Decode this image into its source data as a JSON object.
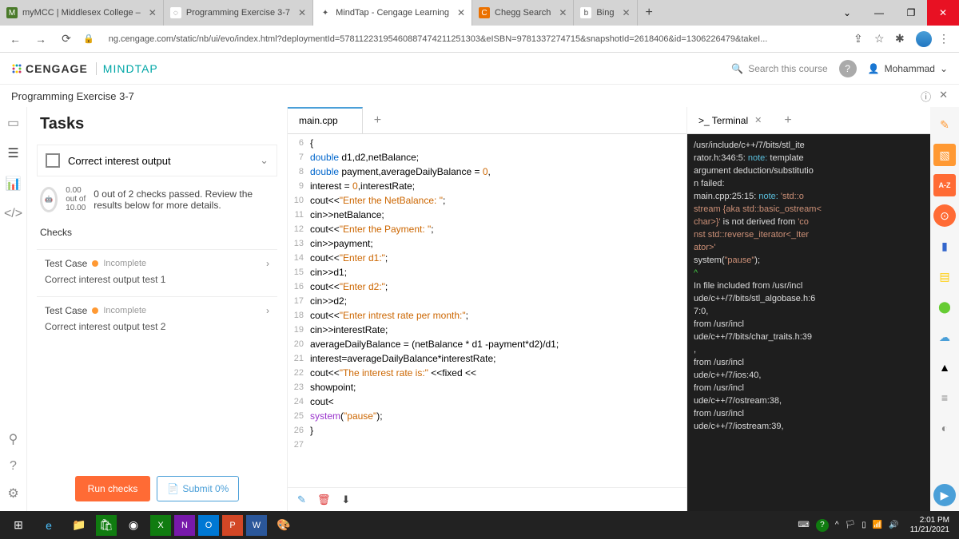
{
  "browser": {
    "tabs": [
      {
        "label": "myMCC | Middlesex College – ",
        "icon": "M",
        "iconbg": "#4a7a2a"
      },
      {
        "label": "Programming Exercise 3-7",
        "icon": "◌",
        "iconbg": "#fff"
      },
      {
        "label": "MindTap - Cengage Learning",
        "icon": "✦",
        "iconbg": "#fff",
        "active": true
      },
      {
        "label": "Chegg Search",
        "icon": "C",
        "iconbg": "#eb7100"
      },
      {
        "label": "Bing",
        "icon": "b",
        "iconbg": "#fff"
      }
    ],
    "url": "ng.cengage.com/static/nb/ui/evo/index.html?deploymentId=57811223195460887474211251303&eISBN=9781337274715&snapshotId=2618406&id=1306226479&takeI..."
  },
  "cengage": {
    "brand": "CENGAGE",
    "product": "MINDTAP",
    "search_placeholder": "Search this course",
    "user": "Mohammad"
  },
  "exercise": {
    "title": "Programming Exercise 3-7"
  },
  "tasks": {
    "heading": "Tasks",
    "item": "Correct interest output",
    "score_num": "0.00",
    "score_den": "10.00",
    "score_mid": "out of",
    "status": "0 out of 2 checks passed. Review the results below for more details.",
    "checks_heading": "Checks",
    "checks": [
      {
        "title": "Test Case",
        "state": "Incomplete",
        "sub": "Correct interest output test 1"
      },
      {
        "title": "Test Case",
        "state": "Incomplete",
        "sub": "Correct interest output test 2"
      }
    ],
    "run": "Run checks",
    "submit": "Submit 0%"
  },
  "editor": {
    "tab": "main.cpp",
    "lines": [
      {
        "n": "6",
        "html": "{"
      },
      {
        "n": "7",
        "html": "<span class='kw'>double</span> d1,d2,netBalance;"
      },
      {
        "n": "8",
        "html": "<span class='kw'>double</span> payment,averageDailyBalance = <span class='num'>0</span>,"
      },
      {
        "n": "9",
        "html": "interest = <span class='num'>0</span>,interestRate;"
      },
      {
        "n": "10",
        "html": "cout&lt;&lt;<span class='str'>\"Enter the NetBalance: \"</span>;"
      },
      {
        "n": "11",
        "html": "cin&gt;&gt;netBalance;"
      },
      {
        "n": "12",
        "html": "cout&lt;&lt;<span class='str'>\"Enter the Payment: \"</span>;"
      },
      {
        "n": "13",
        "html": "cin&gt;&gt;payment;"
      },
      {
        "n": "14",
        "html": "cout&lt;&lt;<span class='str'>\"Enter d1:\"</span>;"
      },
      {
        "n": "15",
        "html": "cin&gt;&gt;d1;"
      },
      {
        "n": "16",
        "html": "cout&lt;&lt;<span class='str'>\"Enter d2:\"</span>;"
      },
      {
        "n": "17",
        "html": "cin&gt;&gt;d2;"
      },
      {
        "n": "18",
        "html": "cout&lt;&lt;<span class='str'>\"Enter intrest rate per month:\"</span>;"
      },
      {
        "n": "19",
        "html": "cin&gt;&gt;interestRate;"
      },
      {
        "n": "20",
        "html": "averageDailyBalance = (netBalance * d1 -payment*d2)/d1;"
      },
      {
        "n": "21",
        "html": "interest=averageDailyBalance*interestRate;"
      },
      {
        "n": "22",
        "html": "cout&lt;&lt;<span class='str'>\"The interest rate is:\"</span> &lt;&lt;fixed &lt;&lt;"
      },
      {
        "n": "23",
        "html": "showpoint;"
      },
      {
        "n": "24",
        "html": "cout&lt;"
      },
      {
        "n": "25",
        "html": "<span class='fn'>system</span>(<span class='str'>\"pause\"</span>);"
      },
      {
        "n": "26",
        "html": "}"
      },
      {
        "n": "27",
        "html": ""
      }
    ]
  },
  "terminal": {
    "tab": ">_ Terminal",
    "lines": [
      "/usr/include/c++/7/bits/stl_ite",
      "rator.h:346:5: <span class='note'>note:</span>   template",
      " argument deduction/substitutio",
      "n failed:",
      "main.cpp:25:15: <span class='note'>note:</span>   <span class='str2'>'std::o</span>",
      "<span class='str2'>stream {aka std::basic_ostream&lt;</span>",
      "<span class='str2'>char&gt;}'</span> is not derived from <span class='str2'>'co</span>",
      "<span class='str2'>nst std::reverse_iterator&lt;_Iter</span>",
      "<span class='str2'>ator&gt;'</span>",
      "     system(<span class='str2'>\"pause\"</span>);",
      "                    <span class='caret'>^</span>",
      "In file included from /usr/incl",
      "ude/c++/7/bits/stl_algobase.h:6",
      "7:0,",
      "                 from /usr/incl",
      "ude/c++/7/bits/char_traits.h:39",
      ",",
      "                 from /usr/incl",
      "ude/c++/7/ios:40,",
      "                 from /usr/incl",
      "ude/c++/7/ostream:38,",
      "                 from /usr/incl",
      "ude/c++/7/iostream:39,"
    ]
  },
  "taskbar": {
    "time": "2:01 PM",
    "date": "11/21/2021"
  }
}
